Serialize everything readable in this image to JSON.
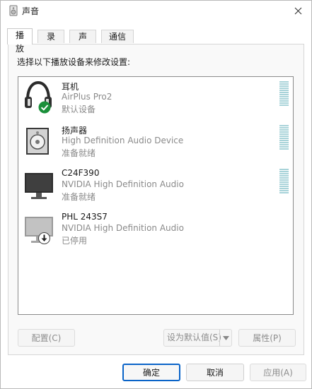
{
  "window": {
    "title": "声音"
  },
  "tabs": [
    {
      "label": "播放",
      "active": true
    },
    {
      "label": "录制",
      "active": false
    },
    {
      "label": "声音",
      "active": false
    },
    {
      "label": "通信",
      "active": false
    }
  ],
  "panel": {
    "instruction": "选择以下播放设备来修改设置:"
  },
  "devices": [
    {
      "name": "耳机",
      "description": "AirPlus Pro2",
      "status": "默认设备",
      "icon": "headphones-icon",
      "badge": "default-check-icon",
      "level_meter": true
    },
    {
      "name": "扬声器",
      "description": "High Definition Audio Device",
      "status": "准备就绪",
      "icon": "speaker-icon",
      "level_meter": true
    },
    {
      "name": "C24F390",
      "description": "NVIDIA High Definition Audio",
      "status": "准备就绪",
      "icon": "monitor-icon",
      "level_meter": true
    },
    {
      "name": "PHL 243S7",
      "description": "NVIDIA High Definition Audio",
      "status": "已停用",
      "icon": "monitor-disabled-icon",
      "badge": "disabled-arrow-icon",
      "level_meter": false
    }
  ],
  "panel_buttons": {
    "configure": "配置(C)",
    "set_default": "设为默认值(S)",
    "properties": "属性(P)"
  },
  "dialog_buttons": {
    "ok": "确定",
    "cancel": "取消",
    "apply": "应用(A)"
  },
  "colors": {
    "accent": "#0a64c8",
    "check_badge": "#1a8f3a",
    "meter": "#a8d3d9"
  }
}
